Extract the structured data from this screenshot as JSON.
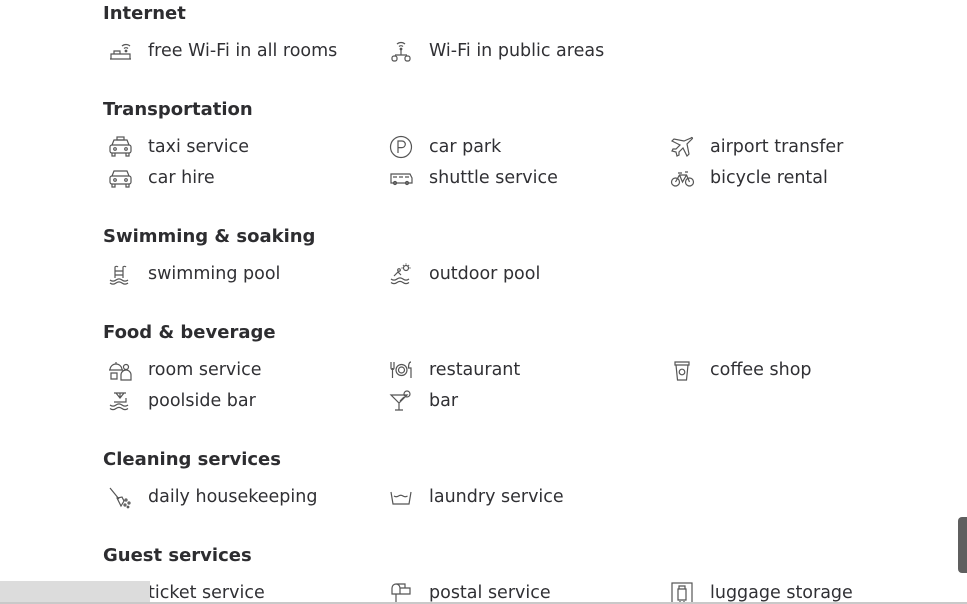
{
  "sections": [
    {
      "heading": "Internet",
      "items": [
        {
          "label": "free Wi-Fi in all rooms",
          "icon": "wifi-room-icon"
        },
        {
          "label": "Wi-Fi in public areas",
          "icon": "wifi-public-icon"
        }
      ]
    },
    {
      "heading": "Transportation",
      "items": [
        {
          "label": "taxi service",
          "icon": "taxi-icon"
        },
        {
          "label": "car park",
          "icon": "parking-icon"
        },
        {
          "label": "airport transfer",
          "icon": "airplane-icon"
        },
        {
          "label": "car hire",
          "icon": "car-icon"
        },
        {
          "label": "shuttle service",
          "icon": "shuttle-bus-icon"
        },
        {
          "label": "bicycle rental",
          "icon": "bicycle-icon"
        }
      ]
    },
    {
      "heading": "Swimming & soaking",
      "items": [
        {
          "label": "swimming pool",
          "icon": "pool-ladder-icon"
        },
        {
          "label": "outdoor pool",
          "icon": "outdoor-pool-icon"
        }
      ]
    },
    {
      "heading": "Food & beverage",
      "items": [
        {
          "label": "room service",
          "icon": "room-service-icon"
        },
        {
          "label": "restaurant",
          "icon": "restaurant-icon"
        },
        {
          "label": "coffee shop",
          "icon": "coffee-cup-icon"
        },
        {
          "label": "poolside bar",
          "icon": "poolside-bar-icon"
        },
        {
          "label": "bar",
          "icon": "cocktail-icon"
        }
      ]
    },
    {
      "heading": "Cleaning services",
      "items": [
        {
          "label": "daily housekeeping",
          "icon": "broom-icon"
        },
        {
          "label": "laundry service",
          "icon": "laundry-icon"
        }
      ]
    },
    {
      "heading": "Guest services",
      "items": [
        {
          "label": "ticket service",
          "icon": "ticket-icon"
        },
        {
          "label": "postal service",
          "icon": "mailbox-icon"
        },
        {
          "label": "luggage storage",
          "icon": "luggage-icon"
        }
      ]
    }
  ]
}
